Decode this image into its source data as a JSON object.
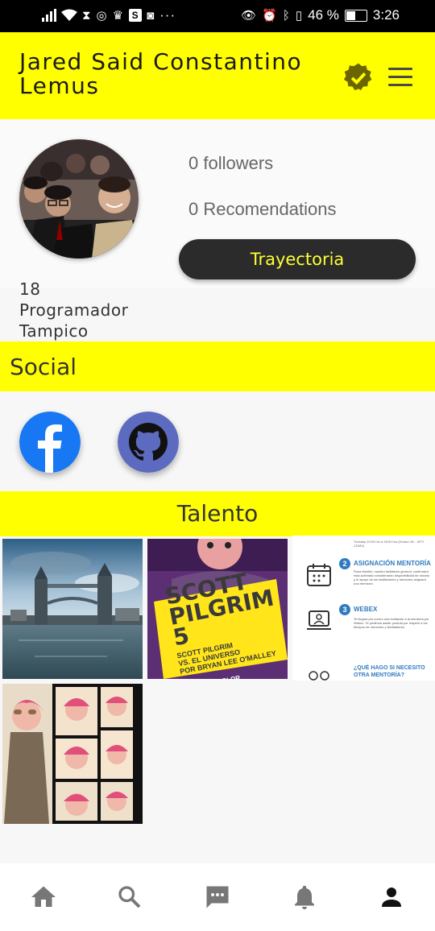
{
  "status_bar": {
    "left_icons": [
      "signal-icon",
      "wifi-icon",
      "hourglass-icon",
      "whatsapp-icon",
      "trophy-icon",
      "s-app-icon",
      "discord-icon",
      "more-dots-icon"
    ],
    "s_label": "S",
    "more": "···",
    "battery_percent": "46 %",
    "time": "3:26"
  },
  "header": {
    "name": "Jared Said Constantino Lemus",
    "verified_icon": "verified-badge-icon",
    "menu_icon": "hamburger-menu-icon",
    "background": "#ffff00"
  },
  "profile": {
    "followers": "0 followers",
    "recommendations": "0 Recomendations",
    "trayectoria_label": "Trayectoria",
    "age": "18",
    "occupation": "Programador",
    "city": "Tampico"
  },
  "social": {
    "title": "Social",
    "links": [
      {
        "name": "facebook",
        "icon": "facebook-icon",
        "color": "#1877f2"
      },
      {
        "name": "github",
        "icon": "github-icon",
        "color": "#5c6bc0"
      }
    ]
  },
  "talento": {
    "title": "Talento",
    "items": [
      "tower-bridge-photo",
      "scott-pilgrim-book-photo",
      "mentoria-document",
      "scott-pilgrim-comic-art"
    ],
    "book": {
      "title1": "SCOTT",
      "title2": "PILGRIM",
      "number": "5",
      "sub1": "SCOTT PILGRIM",
      "sub2": "VS. EL UNIVERSO",
      "author": "POR BRYAN LEE O'MALLEY",
      "edition": "EDICIÓN A COLOR"
    },
    "doc": {
      "top_text": "Tuesday 10:00 hrs a 18:00 hrs (Horas LIN... MTY CDMX)",
      "step2_num": "2",
      "step2_title": "ASIGNACIÓN MENTORÍA",
      "step2_text": "Rosa Montiel, nuestro facilitador general, confirmará esta actividad considerando disponibilidad de horario y el apoyo de los facilitadores y mentores asignará una mentoría",
      "step3_num": "3",
      "step3_title": "WEBEX",
      "step3_text": "Te llegará por correo una invitación a la mentoría por Webex. Te pedimos asistir puntual por respeto a los tiempos de mentores y facilitadores",
      "question": "¿QUÉ HAGO SI NECESITO OTRA MENTORÍA?"
    }
  },
  "bottom_nav": {
    "items": [
      "home-icon",
      "search-icon",
      "chat-icon",
      "notifications-icon",
      "profile-icon"
    ],
    "active_color": "#111111",
    "inactive_color": "#777777"
  }
}
